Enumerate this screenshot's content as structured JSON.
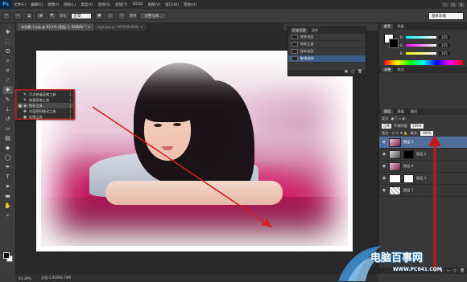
{
  "app": {
    "logo": "Ps"
  },
  "menu": [
    "文件(F)",
    "编辑(E)",
    "图像(I)",
    "图层(L)",
    "类型(Y)",
    "选择(S)",
    "滤镜(T)",
    "3D(D)",
    "视图(V)",
    "窗口(W)",
    "帮助(H)"
  ],
  "window_controls": [
    "–",
    "□",
    "×"
  ],
  "options_bar": {
    "feather_label": "羽化:",
    "mode_value": "正常",
    "checkbox_label": "透明",
    "refine_button": "调整边缘...",
    "workspace": "基本功能"
  },
  "tabs": [
    {
      "label": "未标题-1.jpg @ 83.4% (图层 2, RGB/8) *",
      "active": true
    },
    {
      "label": "logo.jpg @ 100%(RGB/8)",
      "active": false
    }
  ],
  "tool_flyout": {
    "items": [
      {
        "icon": "spot-heal-icon",
        "glyph": "✎",
        "label": "污点修复画笔工具",
        "key": "J",
        "selected": false
      },
      {
        "icon": "heal-brush-icon",
        "glyph": "✎",
        "label": "修复画笔工具",
        "key": "J",
        "selected": false
      },
      {
        "icon": "patch-tool-icon",
        "glyph": "◈",
        "label": "修补工具",
        "key": "J",
        "selected": true
      },
      {
        "icon": "content-aware-move-icon",
        "glyph": "✥",
        "label": "内容感知移动工具",
        "key": "J",
        "selected": false
      },
      {
        "icon": "red-eye-icon",
        "glyph": "◉",
        "label": "红眼工具",
        "key": "J",
        "selected": false
      }
    ]
  },
  "history": {
    "tabs": [
      "历史记录",
      "动作"
    ],
    "rows": [
      {
        "label": "修补选区",
        "current": false
      },
      {
        "label": "修补工具",
        "current": false
      },
      {
        "label": "修补选区",
        "current": false
      },
      {
        "label": "取消选择",
        "current": true
      }
    ],
    "footer_icons": [
      "▣",
      "◫",
      "🗑"
    ]
  },
  "color_panel": {
    "tabs": [
      "颜色",
      "色板"
    ],
    "sliders": [
      {
        "label": "R",
        "value": "255",
        "gradient": "linear-gradient(90deg,#00ffff,#ffffff)"
      },
      {
        "label": "G",
        "value": "255",
        "gradient": "linear-gradient(90deg,#ff00ff,#ffffff)"
      },
      {
        "label": "B",
        "value": "255",
        "gradient": "linear-gradient(90deg,#ffff00,#ffffff)"
      }
    ]
  },
  "adjust_panel": {
    "tabs": [
      "调整",
      "样式"
    ]
  },
  "layers_panel": {
    "tabs": [
      "图层",
      "通道",
      "路径"
    ],
    "kind_label": "类型",
    "blend_mode": "正常",
    "opacity_label": "不透明度:",
    "opacity_value": "100%",
    "lock_label": "锁定:",
    "fill_label": "填充:",
    "fill_value": "100%",
    "layers": [
      {
        "name": "图层 2",
        "selected": true,
        "thumb": "linear-gradient(135deg,#e7c3d6,#7b1743)",
        "mask": ""
      },
      {
        "name": "图层 2",
        "selected": false,
        "thumb": "linear-gradient(135deg,#ddd,#444)",
        "mask": "#000"
      },
      {
        "name": "图层 0",
        "selected": false,
        "thumb": "linear-gradient(135deg,#e7c3d6,#7b1743)",
        "mask": ""
      },
      {
        "name": "图层 1",
        "selected": false,
        "thumb": "#ffffff",
        "mask": "#fff"
      },
      {
        "name": "图层 1",
        "selected": false,
        "thumb": "repeating-linear-gradient(45deg,#bbb 0 2px,#fff 2px 4px)",
        "mask": ""
      }
    ],
    "footer_icons": [
      "ƒx",
      "◐",
      "▭",
      "◫",
      "🗑"
    ]
  },
  "status": {
    "zoom": "83.39%",
    "doc": "文档:1.91M/4.79M"
  },
  "watermark": {
    "text": "电脑百事网",
    "url": "WWW.PC841.COM"
  },
  "accent": {
    "history_current": "#3e5d86",
    "layer_selected": "#4f6f99",
    "annotation_red": "#d42020"
  }
}
